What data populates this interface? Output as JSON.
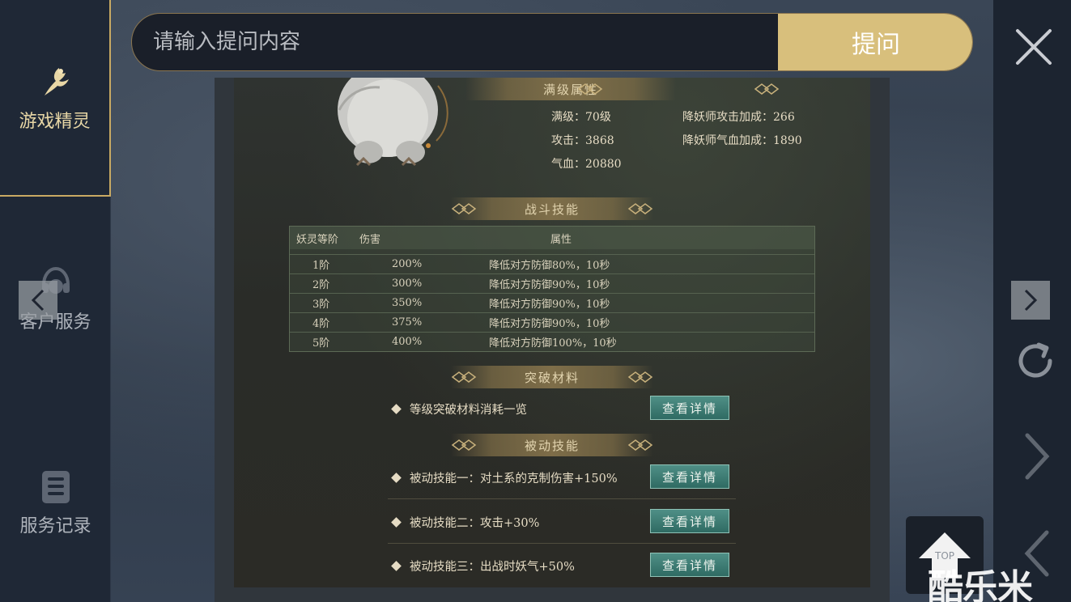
{
  "sidebar": {
    "items": [
      {
        "label": "游戏精灵",
        "icon": "fairy-icon",
        "active": true
      },
      {
        "label": "客户服务",
        "icon": "headset-icon",
        "active": false
      },
      {
        "label": "服务记录",
        "icon": "list-icon",
        "active": false
      }
    ]
  },
  "search": {
    "placeholder": "请输入提问内容",
    "button_label": "提问"
  },
  "content": {
    "max_level": {
      "title": "满级属性",
      "stats": [
        "满级：70级",
        "攻击：3868",
        "气血：20880",
        "降妖师攻击加成：266",
        "降妖师气血加成：1890"
      ]
    },
    "battle_skill": {
      "title": "战斗技能",
      "columns": [
        "妖灵等阶",
        "伤害",
        "属性"
      ],
      "rows": [
        [
          "1阶",
          "200%",
          "降低对方防御80%，10秒"
        ],
        [
          "2阶",
          "300%",
          "降低对方防御90%，10秒"
        ],
        [
          "3阶",
          "350%",
          "降低对方防御90%，10秒"
        ],
        [
          "4阶",
          "375%",
          "降低对方防御90%，10秒"
        ],
        [
          "5阶",
          "400%",
          "降低对方防御100%，10秒"
        ]
      ]
    },
    "breakthrough": {
      "title": "突破材料",
      "items": [
        {
          "text": "等级突破材料消耗一览",
          "button": "查看详情"
        }
      ]
    },
    "passive": {
      "title": "被动技能",
      "items": [
        {
          "text": "被动技能一：对土系的克制伤害+150%",
          "button": "查看详情"
        },
        {
          "text": "被动技能二：攻击+30%",
          "button": "查看详情"
        },
        {
          "text": "被动技能三：出战时妖气+50%",
          "button": "查看详情"
        }
      ]
    }
  },
  "top_button": {
    "label": "TOP"
  },
  "watermark": "酷乐米",
  "colors": {
    "accent_gold": "#d8bf7c",
    "detail_button": "#3f7d74",
    "sidebar_bg": "#1f2836"
  }
}
